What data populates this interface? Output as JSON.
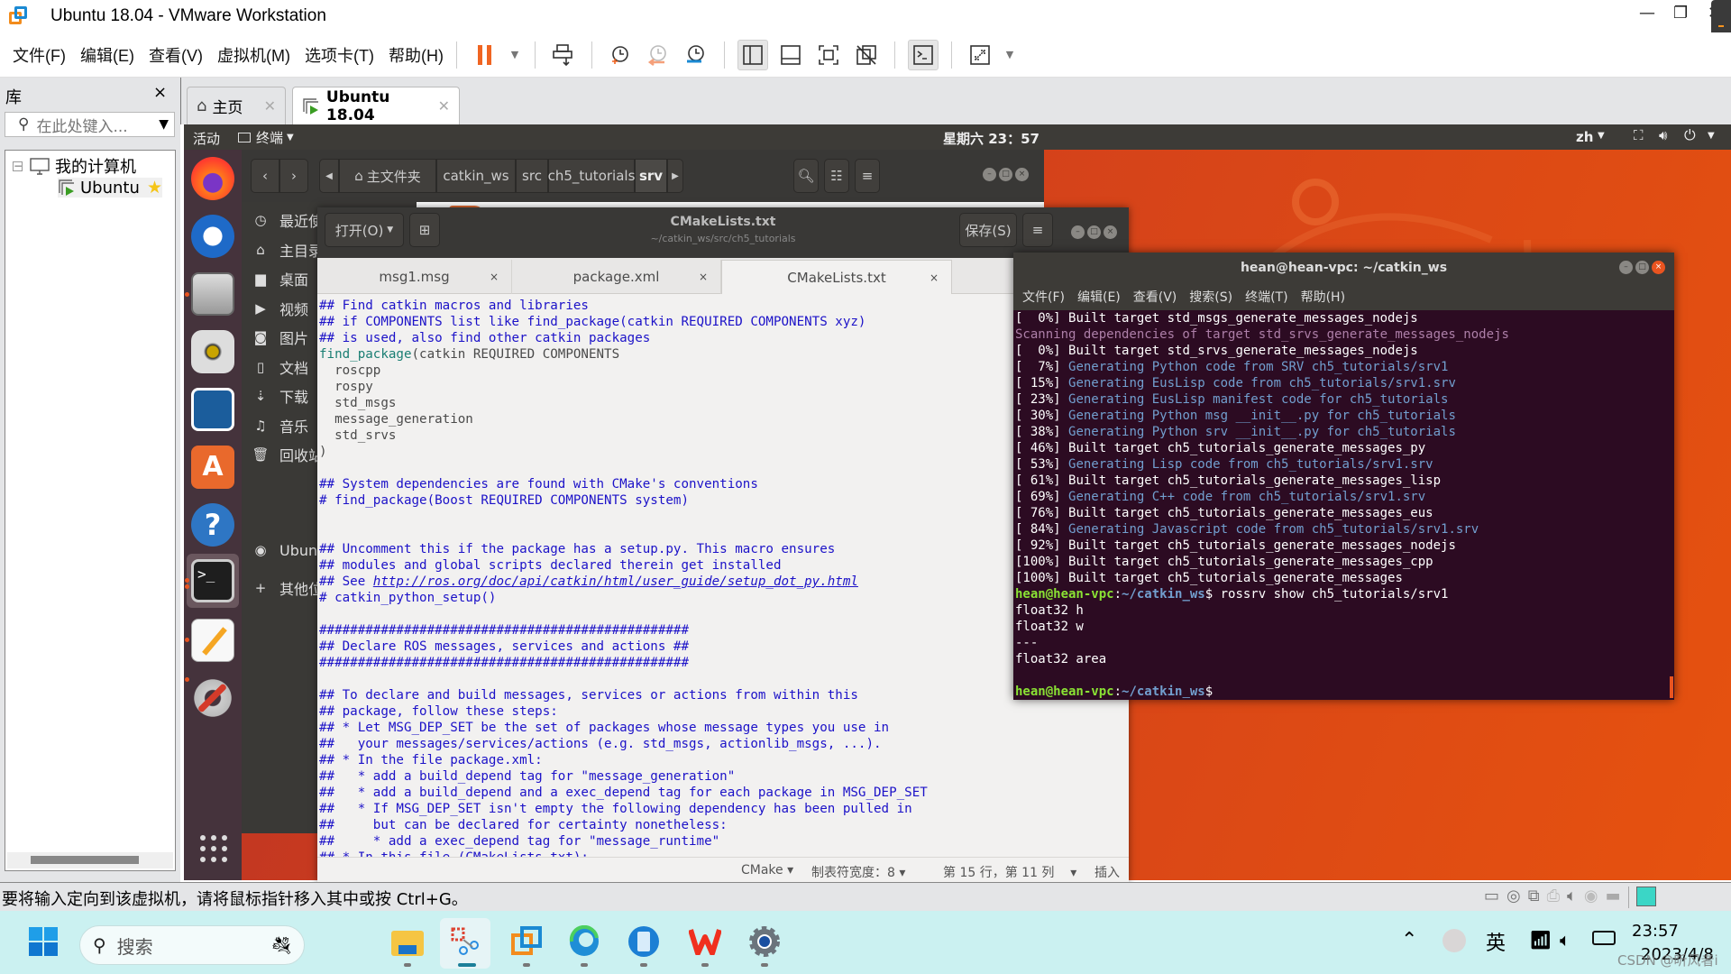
{
  "window": {
    "title": "Ubuntu 18.04 - VMware Workstation",
    "controls": {
      "minimize": "—",
      "restore": "❐",
      "close": "✕"
    }
  },
  "menubar": {
    "items": [
      "文件(F)",
      "编辑(E)",
      "查看(V)",
      "虚拟机(M)",
      "选项卡(T)",
      "帮助(H)"
    ],
    "toolbar_icons": [
      "pause-icon",
      "dropdown-icon",
      "send-ctrl-alt-del-icon",
      "snapshot-take-icon",
      "snapshot-revert-icon",
      "snapshot-manager-icon",
      "library-view-icon",
      "thumbnail-bar-icon",
      "fullscreen-icon",
      "unity-icon",
      "console-view-icon",
      "stretch-icon",
      "dropdown-icon"
    ]
  },
  "library": {
    "title": "库",
    "close": "×",
    "search_placeholder": "在此处键入...",
    "tree": {
      "root": "我的计算机",
      "vm": "Ubuntu"
    }
  },
  "vm_tabs": [
    {
      "label": "主页",
      "icon": "home-icon",
      "active": false
    },
    {
      "label": "Ubuntu 18.04",
      "icon": "vm-icon",
      "active": true
    }
  ],
  "ubuntu_topbar": {
    "activities": "活动",
    "app_menu": "终端",
    "clock": "星期六 23：57",
    "input_method": "zh"
  },
  "nautilus": {
    "path": [
      "主文件夹",
      "catkin_ws",
      "src",
      "ch5_tutorials",
      "srv"
    ],
    "sidebar": [
      {
        "icon": "clock-icon",
        "label": "最近使用"
      },
      {
        "icon": "home-icon",
        "label": "主目录"
      },
      {
        "icon": "folder-icon",
        "label": "桌面"
      },
      {
        "icon": "video-icon",
        "label": "视频"
      },
      {
        "icon": "camera-icon",
        "label": "图片"
      },
      {
        "icon": "document-icon",
        "label": "文档"
      },
      {
        "icon": "download-icon",
        "label": "下载"
      },
      {
        "icon": "music-icon",
        "label": "音乐"
      },
      {
        "icon": "trash-icon",
        "label": "回收站"
      },
      {
        "icon": "disc-icon",
        "label": "Ubuntu"
      },
      {
        "icon": "plus-icon",
        "label": "其他位置"
      }
    ]
  },
  "gedit": {
    "open_label": "打开(O)",
    "save_label": "保存(S)",
    "title": "CMakeLists.txt",
    "subtitle": "~/catkin_ws/src/ch5_tutorials",
    "tabs": [
      {
        "label": "msg1.msg",
        "active": false
      },
      {
        "label": "package.xml",
        "active": false
      },
      {
        "label": "CMakeLists.txt",
        "active": true
      }
    ],
    "code_lines": [
      {
        "t": "cm",
        "s": "## Find catkin macros and libraries"
      },
      {
        "t": "cm",
        "s": "## if COMPONENTS list like find_package(catkin REQUIRED COMPONENTS xyz)"
      },
      {
        "t": "cm",
        "s": "## is used, also find other catkin packages"
      },
      {
        "t": "fn",
        "s": "find_package",
        "rest": "(catkin REQUIRED COMPONENTS"
      },
      {
        "t": "tx",
        "s": "  roscpp"
      },
      {
        "t": "tx",
        "s": "  rospy"
      },
      {
        "t": "tx",
        "s": "  std_msgs"
      },
      {
        "t": "tx",
        "s": "  message_generation"
      },
      {
        "t": "tx",
        "s": "  std_srvs"
      },
      {
        "t": "tx",
        "s": ")"
      },
      {
        "t": "tx",
        "s": ""
      },
      {
        "t": "cm",
        "s": "## System dependencies are found with CMake's conventions"
      },
      {
        "t": "cm",
        "s": "# find_package(Boost REQUIRED COMPONENTS system)"
      },
      {
        "t": "tx",
        "s": ""
      },
      {
        "t": "tx",
        "s": ""
      },
      {
        "t": "cm",
        "s": "## Uncomment this if the package has a setup.py. This macro ensures"
      },
      {
        "t": "cm",
        "s": "## modules and global scripts declared therein get installed"
      },
      {
        "t": "lk",
        "s": "## See ",
        "link": "http://ros.org/doc/api/catkin/html/user_guide/setup_dot_py.html"
      },
      {
        "t": "cm",
        "s": "# catkin_python_setup()"
      },
      {
        "t": "tx",
        "s": ""
      },
      {
        "t": "cm",
        "s": "################################################"
      },
      {
        "t": "cm",
        "s": "## Declare ROS messages, services and actions ##"
      },
      {
        "t": "cm",
        "s": "################################################"
      },
      {
        "t": "tx",
        "s": ""
      },
      {
        "t": "cm",
        "s": "## To declare and build messages, services or actions from within this"
      },
      {
        "t": "cm",
        "s": "## package, follow these steps:"
      },
      {
        "t": "cm",
        "s": "## * Let MSG_DEP_SET be the set of packages whose message types you use in"
      },
      {
        "t": "cm",
        "s": "##   your messages/services/actions (e.g. std_msgs, actionlib_msgs, ...)."
      },
      {
        "t": "cm",
        "s": "## * In the file package.xml:"
      },
      {
        "t": "cm",
        "s": "##   * add a build_depend tag for \"message_generation\""
      },
      {
        "t": "cm",
        "s": "##   * add a build_depend and a exec_depend tag for each package in MSG_DEP_SET"
      },
      {
        "t": "cm",
        "s": "##   * If MSG_DEP_SET isn't empty the following dependency has been pulled in"
      },
      {
        "t": "cm",
        "s": "##     but can be declared for certainty nonetheless:"
      },
      {
        "t": "cm",
        "s": "##     * add a exec_depend tag for \"message_runtime\""
      },
      {
        "t": "cm",
        "s": "## * In this file (CMakeLists.txt):"
      }
    ],
    "status": {
      "language": "CMake",
      "tab_width": "制表符宽度：8",
      "position": "第 15 行，第 11 列",
      "mode": "插入"
    }
  },
  "terminal": {
    "title": "hean@hean-vpc: ~/catkin_ws",
    "menu": [
      "文件(F)",
      "编辑(E)",
      "查看(V)",
      "搜索(S)",
      "终端(T)",
      "帮助(H)"
    ],
    "lines": [
      {
        "p": "[  0%] ",
        "t": "w",
        "s": "Built target std_msgs_generate_messages_nodejs"
      },
      {
        "p": "",
        "t": "purple",
        "s": "Scanning dependencies of target std_srvs_generate_messages_nodejs"
      },
      {
        "p": "[  0%] ",
        "t": "w",
        "s": "Built target std_srvs_generate_messages_nodejs"
      },
      {
        "p": "[  7%] ",
        "t": "blue",
        "s": "Generating Python code from SRV ch5_tutorials/srv1"
      },
      {
        "p": "[ 15%] ",
        "t": "blue",
        "s": "Generating EusLisp code from ch5_tutorials/srv1.srv"
      },
      {
        "p": "[ 23%] ",
        "t": "blue",
        "s": "Generating EusLisp manifest code for ch5_tutorials"
      },
      {
        "p": "[ 30%] ",
        "t": "blue",
        "s": "Generating Python msg __init__.py for ch5_tutorials"
      },
      {
        "p": "[ 38%] ",
        "t": "blue",
        "s": "Generating Python srv __init__.py for ch5_tutorials"
      },
      {
        "p": "[ 46%] ",
        "t": "w",
        "s": "Built target ch5_tutorials_generate_messages_py"
      },
      {
        "p": "[ 53%] ",
        "t": "blue",
        "s": "Generating Lisp code from ch5_tutorials/srv1.srv"
      },
      {
        "p": "[ 61%] ",
        "t": "w",
        "s": "Built target ch5_tutorials_generate_messages_lisp"
      },
      {
        "p": "[ 69%] ",
        "t": "blue",
        "s": "Generating C++ code from ch5_tutorials/srv1.srv"
      },
      {
        "p": "[ 76%] ",
        "t": "w",
        "s": "Built target ch5_tutorials_generate_messages_eus"
      },
      {
        "p": "[ 84%] ",
        "t": "blue",
        "s": "Generating Javascript code from ch5_tutorials/srv1.srv"
      },
      {
        "p": "[ 92%] ",
        "t": "w",
        "s": "Built target ch5_tutorials_generate_messages_nodejs"
      },
      {
        "p": "[100%] ",
        "t": "w",
        "s": "Built target ch5_tutorials_generate_messages_cpp"
      },
      {
        "p": "[100%] ",
        "t": "w",
        "s": "Built target ch5_tutorials_generate_messages"
      },
      {
        "p": "",
        "t": "prompt",
        "user": "hean@hean-vpc",
        "path": "~/catkin_ws",
        "s": "$ rossrv show ch5_tutorials/srv1"
      },
      {
        "p": "",
        "t": "w",
        "s": "float32 h"
      },
      {
        "p": "",
        "t": "w",
        "s": "float32 w"
      },
      {
        "p": "",
        "t": "w",
        "s": "---"
      },
      {
        "p": "",
        "t": "w",
        "s": "float32 area"
      },
      {
        "p": "",
        "t": "w",
        "s": ""
      },
      {
        "p": "",
        "t": "prompt",
        "user": "hean@hean-vpc",
        "path": "~/catkin_ws",
        "s": "$"
      }
    ]
  },
  "dock": [
    "firefox-icon",
    "thunderbird-icon",
    "files-icon",
    "rhythmbox-icon",
    "libreoffice-writer-icon",
    "software-center-icon",
    "help-icon",
    "terminal-icon",
    "text-editor-icon",
    "system-tools-icon",
    "app-grid-icon"
  ],
  "vm_status": {
    "message": "要将输入定向到该虚拟机，请将鼠标指针移入其中或按 Ctrl+G。",
    "device_icons": [
      "hdd-icon",
      "cdrom-icon",
      "network-icon",
      "printer-icon",
      "sound-icon",
      "camera-icon",
      "usb-icon",
      "notes-icon"
    ]
  },
  "taskbar": {
    "search_placeholder": "搜索",
    "apps": [
      "windows-start-icon",
      "file-explorer-icon",
      "snipping-tool-icon",
      "vmware-icon",
      "edge-icon",
      "phone-link-icon",
      "wps-icon",
      "settings-icon"
    ],
    "tray": {
      "ime": "英",
      "time": "23:57",
      "date": "2023/4/8"
    },
    "watermark": "CSDN @听风者i"
  }
}
